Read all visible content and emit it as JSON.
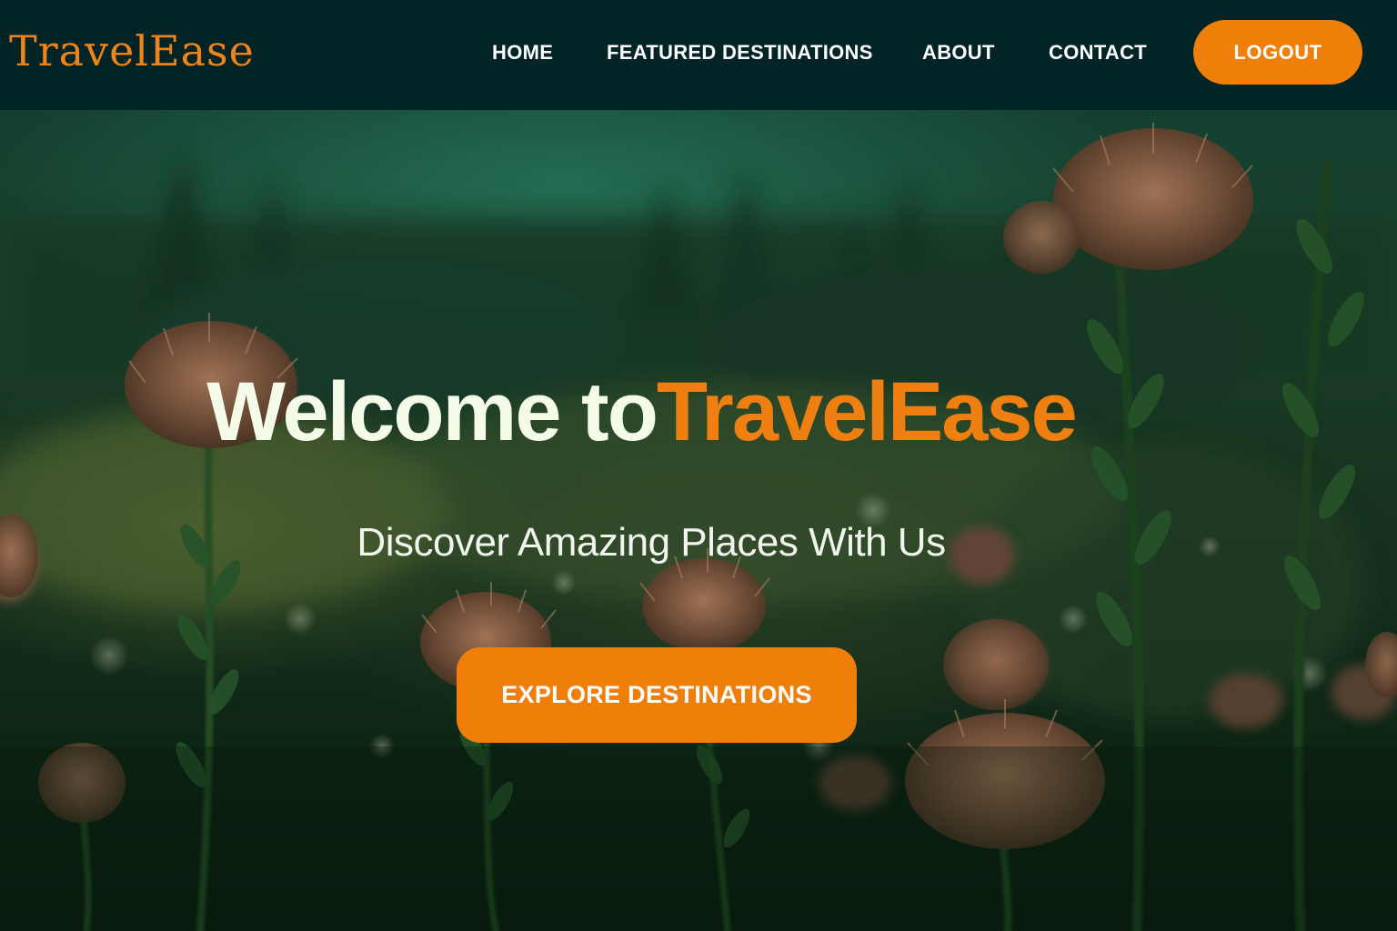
{
  "header": {
    "logo_text": "TravelEase",
    "nav": {
      "home": "HOME",
      "featured": "FEATURED DESTINATIONS",
      "about": "ABOUT",
      "contact": "CONTACT"
    },
    "logout_label": "LOGOUT"
  },
  "hero": {
    "title_lead": "Welcome to",
    "title_brand": "TravelEase",
    "subtitle": "Discover Amazing Places With Us",
    "cta_label": "EXPLORE DESTINATIONS",
    "background_image": "blurred field of protea flowers with trees and green sky"
  },
  "colors": {
    "navbar_bg": "#022427",
    "accent": "#f07f0a",
    "logo": "#ef8419",
    "hero_text": "#f4fbe9"
  },
  "icons": []
}
